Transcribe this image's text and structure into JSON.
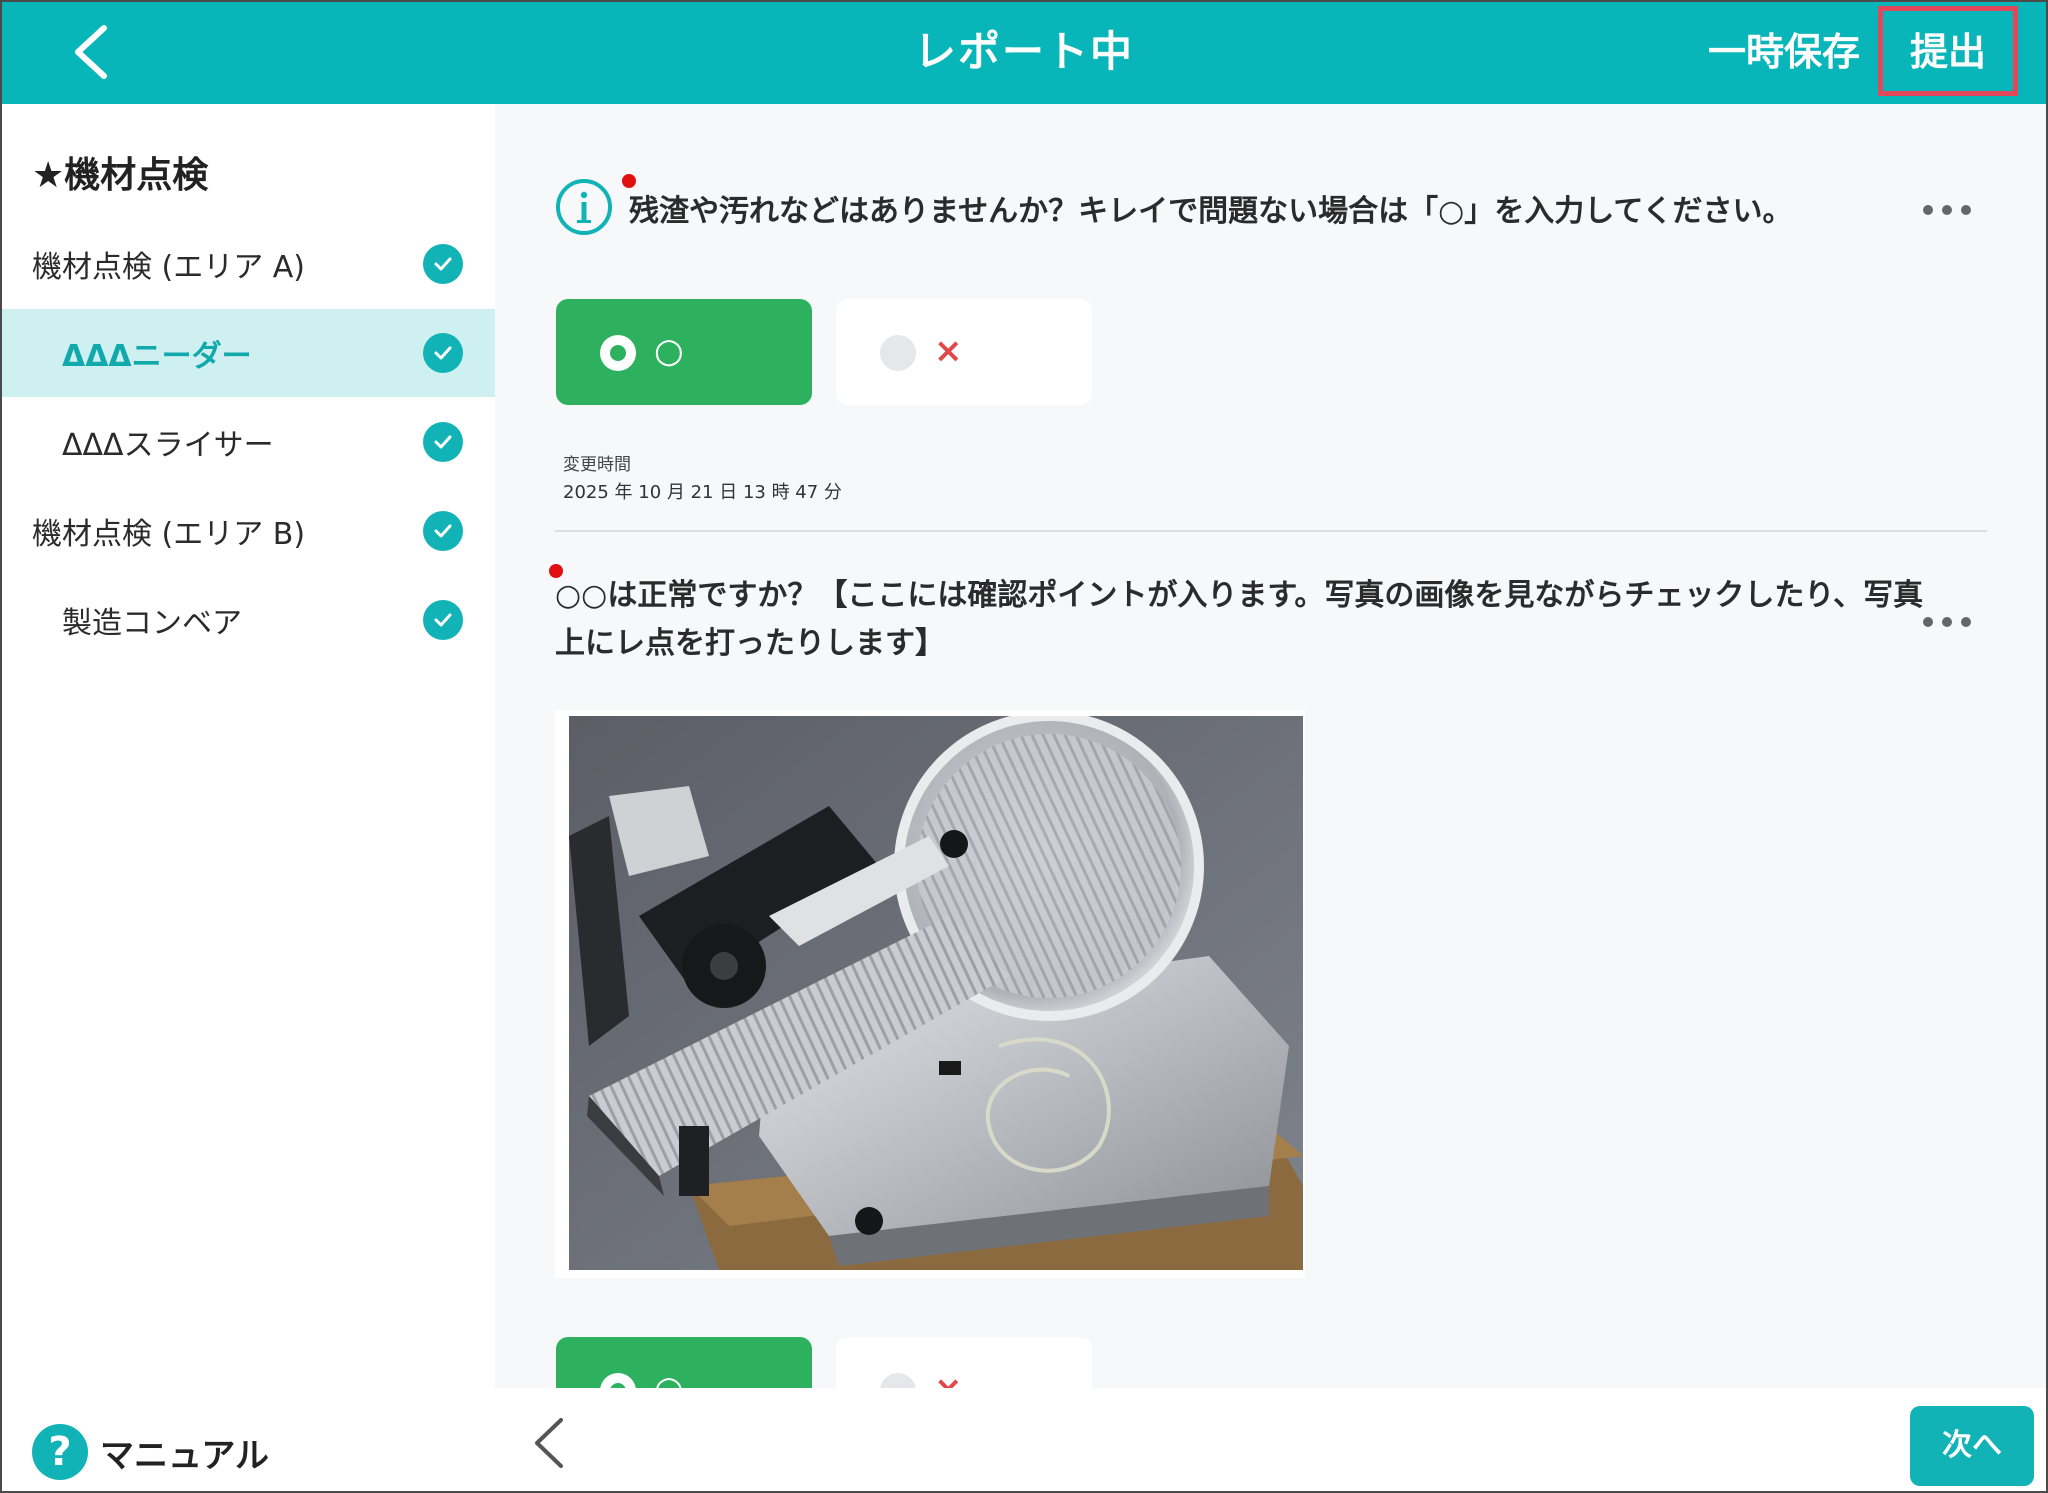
{
  "header": {
    "title": "レポート中",
    "save_label": "一時保存",
    "submit_label": "提出"
  },
  "sidebar": {
    "title": "★機材点検",
    "items": [
      {
        "label": "機材点検 (エリア A)",
        "checked": true
      },
      {
        "label": "ΔΔΔニーダー",
        "checked": true,
        "active": true
      },
      {
        "label": "ΔΔΔスライサー",
        "checked": true
      },
      {
        "label": "機材点検 (エリア B)",
        "checked": true
      },
      {
        "label": "製造コンベア",
        "checked": true
      }
    ],
    "manual_label": "マニュアル",
    "manual_icon": "?"
  },
  "questions": [
    {
      "text": "残渣や汚れなどはありませんか？キレイで問題ない場合は「○」を入力してください。",
      "options": [
        {
          "label": "○",
          "selected": true
        },
        {
          "label": "×",
          "selected": false
        }
      ],
      "changed_label": "変更時間",
      "changed_value": "2025 年 10 月 21 日 13 時 47 分"
    },
    {
      "text": "○○は正常ですか？【ここには確認ポイントが入ります。写真の画像を見ながらチェックしたり、写真上にレ点を打ったりします】",
      "options": [
        {
          "label": "○",
          "selected": true
        },
        {
          "label": "×",
          "selected": false
        }
      ]
    }
  ],
  "footer": {
    "next_label": "次へ"
  },
  "colors": {
    "primary": "#08b5b8",
    "selected_option": "#2db15e",
    "submit_highlight": "#e2485a",
    "required_dot": "#e01010"
  }
}
